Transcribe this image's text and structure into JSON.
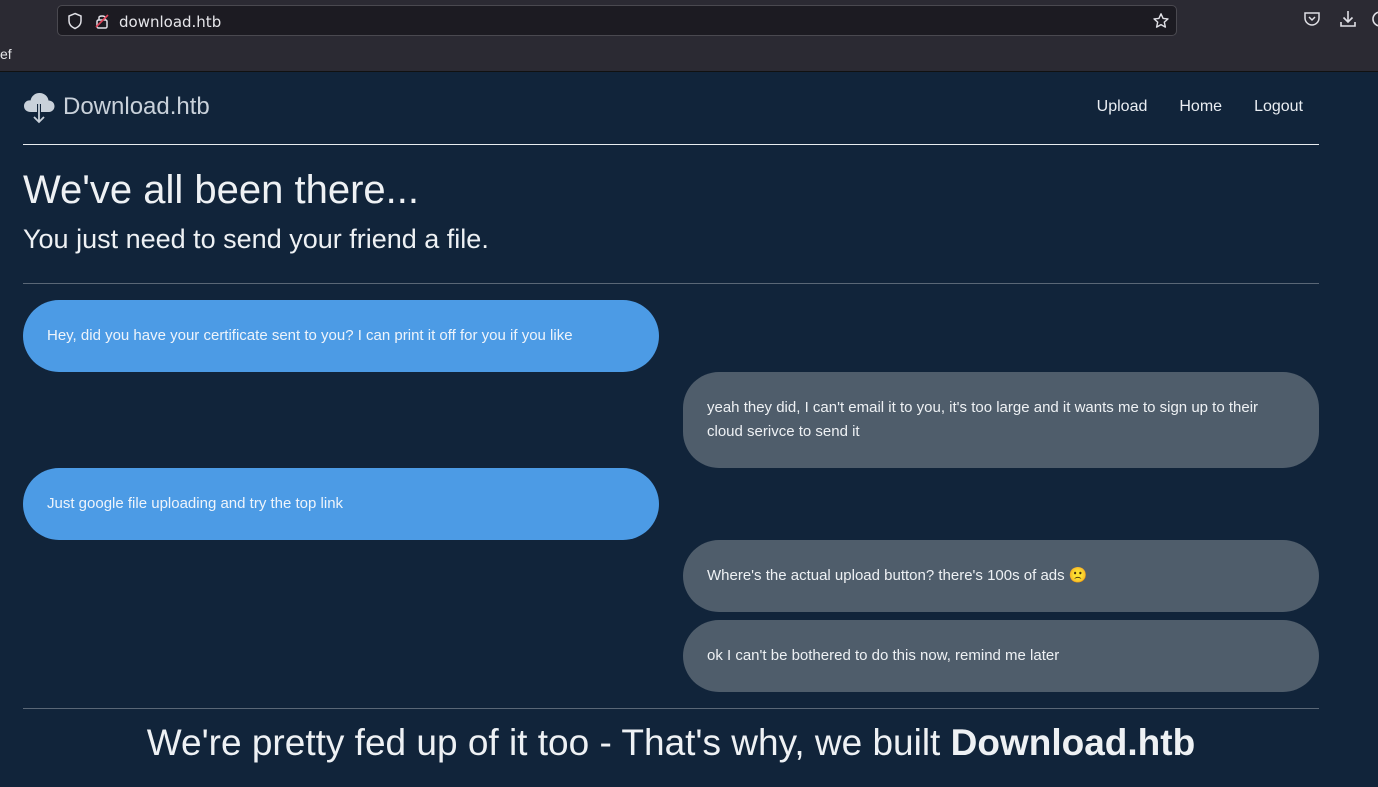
{
  "browser": {
    "url": "download.htb",
    "bookmark_fragment": "ef"
  },
  "nav": {
    "brand": "Download.htb",
    "links": [
      "Upload",
      "Home",
      "Logout"
    ]
  },
  "hero": {
    "title": "We've all been there...",
    "subtitle": "You just need to send your friend a file."
  },
  "chat": [
    {
      "side": "left",
      "text": "Hey, did you have your certificate sent to you? I can print it off for you if you like"
    },
    {
      "side": "right",
      "text": "yeah they did, I can't email it to you, it's too large and it wants me to sign up to their cloud serivce to send it"
    },
    {
      "side": "left",
      "text": "Just google file uploading and try the top link"
    },
    {
      "side": "right",
      "text": "Where's the actual upload button? there's 100s of ads 🙁"
    },
    {
      "side": "right",
      "text": "ok I can't be bothered to do this now, remind me later"
    }
  ],
  "footer": {
    "prefix": "We're pretty fed up of it too - That's why, we built ",
    "brand": "Download.htb"
  },
  "colors": {
    "page_bg": "#11243a",
    "bubble_left": "#4c9be5",
    "bubble_right": "#4f5d6b"
  }
}
